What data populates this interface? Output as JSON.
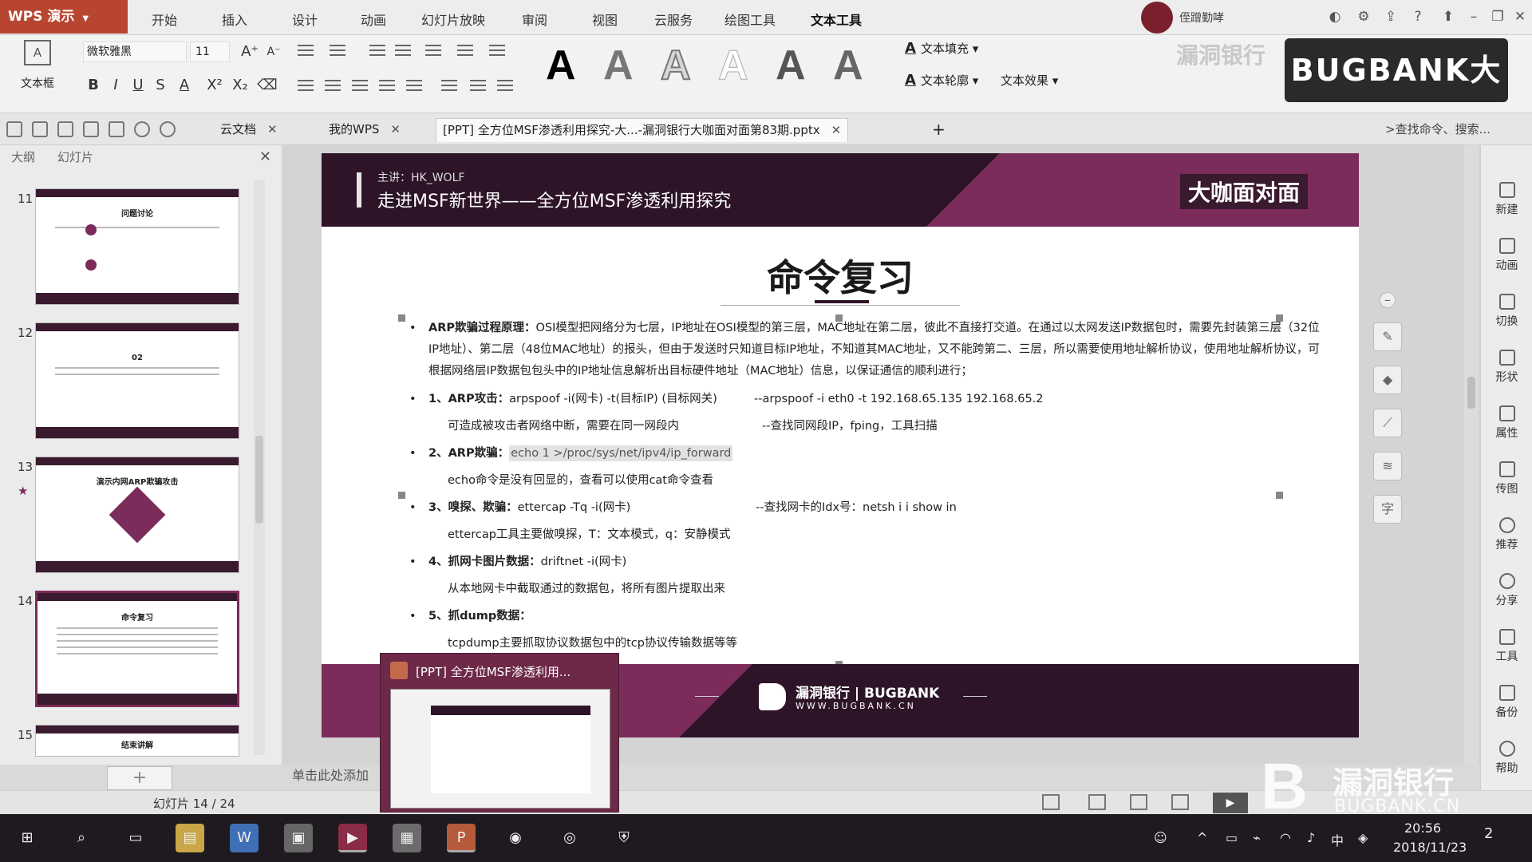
{
  "app": {
    "name": "WPS 演示",
    "menu": [
      "开始",
      "插入",
      "设计",
      "动画",
      "幻灯片放映",
      "审阅",
      "视图",
      "云服务",
      "绘图工具",
      "文本工具"
    ],
    "active_menu": "文本工具",
    "user_name": "侄蹭勤哮"
  },
  "ribbon": {
    "textbox_label": "文本框",
    "font_name": "微软雅黑",
    "font_size": "11",
    "style_glyph": "A",
    "text_fill": "文本填充",
    "text_outline": "文本轮廓",
    "text_effect": "文本效果",
    "logo_ghost": "漏洞银行",
    "brand": "BUGBANK大咖面对面"
  },
  "tabs": {
    "cloud_doc": "云文档",
    "my_wps": "我的WPS",
    "document": "[PPT] 全方位MSF渗透利用探究-大...-漏洞银行大咖面对面第83期.pptx",
    "search": ">查找命令、搜索..."
  },
  "left_pane": {
    "tab_outline": "大纲",
    "tab_slides": "幻灯片",
    "thumbs": [
      {
        "num": "11",
        "title": "问题讨论"
      },
      {
        "num": "12",
        "title": "02"
      },
      {
        "num": "13",
        "title": "演示内网ARP欺骗攻击"
      },
      {
        "num": "14",
        "title": "命令复习"
      },
      {
        "num": "15",
        "title": "结束讲解"
      }
    ],
    "add_label": "+"
  },
  "slide": {
    "presenter": "主讲：HK_WOLF",
    "header_title": "走进MSF新世界——全方位MSF渗透利用探究",
    "header_brand": "大咖面对面",
    "title": "命令复习",
    "intro_lead": "ARP欺骗过程原理：",
    "intro_text": "OSI模型把网络分为七层，IP地址在OSI模型的第三层，MAC地址在第二层，彼此不直接打交道。在通过以太网发送IP数据包时，需要先封装第三层（32位IP地址）、第二层（48位MAC地址）的报头，但由于发送时只知道目标IP地址，不知道其MAC地址，又不能跨第二、三层，所以需要使用地址解析协议，使用地址解析协议，可根据网络层IP数据包包头中的IP地址信息解析出目标硬件地址（MAC地址）信息，以保证通信的顺利进行；",
    "items": [
      {
        "lead": "1、ARP攻击：",
        "cmd": "arpspoof -i(网卡) -t(目标IP) (目标网关)",
        "right": "--arpspoof -i eth0 -t 192.168.65.135 192.168.65.2",
        "note": "可造成被攻击者网络中断，需要在同一网段内",
        "note_right": "--查找同网段IP，fping，工具扫描"
      },
      {
        "lead": "2、ARP欺骗：",
        "cmd": "echo 1 >/proc/sys/net/ipv4/ip_forward",
        "right": "",
        "note": "echo命令是没有回显的，查看可以使用cat命令查看",
        "note_right": ""
      },
      {
        "lead": "3、嗅探、欺骗：",
        "cmd": "ettercap -Tq -i(网卡)",
        "right": "--查找网卡的Idx号：netsh i i show in",
        "note": "ettercap工具主要做嗅探，T：文本模式，q：安静模式",
        "note_right": ""
      },
      {
        "lead": "4、抓网卡图片数据：",
        "cmd": "driftnet -i(网卡)",
        "right": "",
        "note": "从本地网卡中截取通过的数据包，将所有图片提取出来",
        "note_right": ""
      },
      {
        "lead": "5、抓dump数据：",
        "cmd": "",
        "right": "",
        "note": "tcpdump主要抓取协议数据包中的tcp协议传输数据等等",
        "note_right": ""
      }
    ],
    "footer_brand": "漏洞银行 | BUGBANK",
    "footer_url": "WWW.BUGBANK.CN"
  },
  "notes_hint": "单击此处添加",
  "right_pane": [
    "新建",
    "动画",
    "切换",
    "形状",
    "属性",
    "传图",
    "推荐",
    "分享",
    "工具",
    "备份",
    "帮助"
  ],
  "status": {
    "slide_counter": "幻灯片 14 / 24"
  },
  "watermark": {
    "mark": "B",
    "cn": "漏洞银行",
    "en": "BUGBANK.CN"
  },
  "task_preview": {
    "title": "[PPT] 全方位MSF渗透利用..."
  },
  "taskbar": {
    "time": "20:56",
    "date": "2018/11/23",
    "ime": "中",
    "notifications": "2"
  },
  "colors": {
    "accent": "#7b2c5a",
    "dark": "#2d1428",
    "app_button": "#b8452f"
  }
}
